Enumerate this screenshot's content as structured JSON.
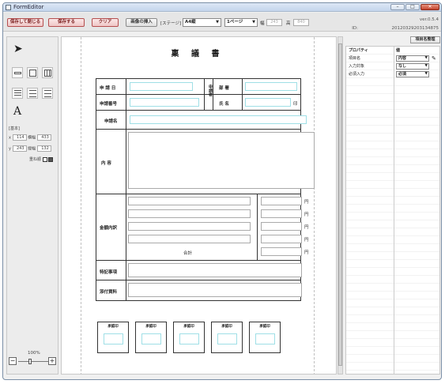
{
  "window": {
    "title": "FormEditor",
    "controls": [
      "–",
      "□",
      "✕"
    ]
  },
  "toolbar": {
    "save_close": "保存して閉じる",
    "save": "保存する",
    "clear": "クリア",
    "insert_image": "画像の挿入",
    "stage_label": "[ステージ]",
    "paper_size": "A4縦",
    "pages": "1ページ",
    "width_label": "幅",
    "width_value": "243",
    "height_label": "高",
    "height_value": "840",
    "version": "ver.0.5.4",
    "id_label": "ID:",
    "id_value": "20120329203134875"
  },
  "palette": {
    "tools": [
      "select-arrow-icon",
      "textbox-icon",
      "square-icon",
      "grid-icon",
      "list-icon",
      "radio-list-icon",
      "checkbox-list-icon",
      "text-icon"
    ],
    "section": "[基本]",
    "x_label": "x",
    "x_value": "114",
    "w_label": "横幅",
    "w_value": "433",
    "y_label": "y",
    "y_value": "243",
    "h_label": "縦幅",
    "h_value": "132",
    "order_label": "重ね順",
    "zoom": "100%",
    "zoom_out": "−",
    "zoom_in": "+"
  },
  "document": {
    "title": "稟 議 書",
    "apply_date": "申 請 日",
    "applicant": "申請者",
    "department": "部 署",
    "apply_no": "申請番号",
    "name": "氏 名",
    "seal": "印",
    "item_name": "申請名",
    "content": "内 容",
    "amount": "金額内訳",
    "yen": [
      "円",
      "円",
      "円",
      "円",
      "円"
    ],
    "total": "合計",
    "special": "特記事項",
    "attachments": "添付資料",
    "stamps": [
      "承認印",
      "承認印",
      "承認印",
      "承認印",
      "承認印"
    ]
  },
  "properties": {
    "button": "項目名整理",
    "header_name": "プロパティ",
    "header_value": "値",
    "rows": [
      {
        "name": "項目名",
        "value": "内容"
      },
      {
        "name": "入力対象",
        "value": "なし"
      },
      {
        "name": "必須入力",
        "value": "必須"
      }
    ]
  }
}
